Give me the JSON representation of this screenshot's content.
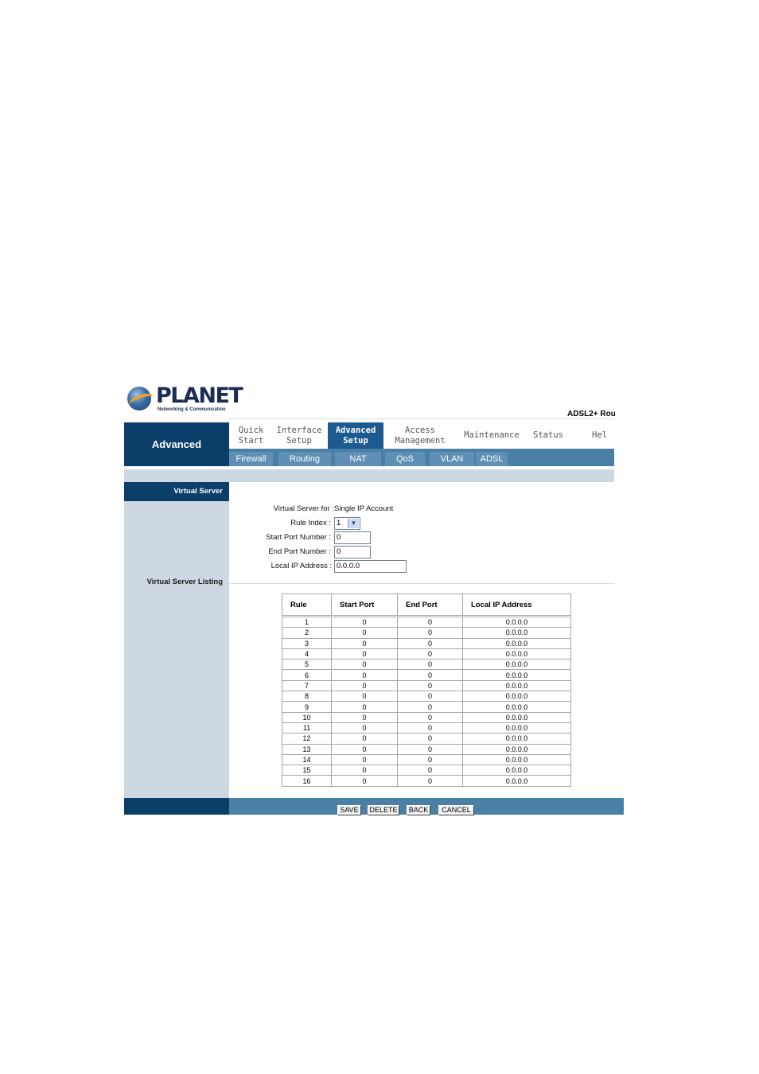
{
  "header": {
    "brand": "PLANET",
    "brand_tagline": "Networking & Communication",
    "product": "ADSL2+ Rou"
  },
  "nav": {
    "section": "Advanced",
    "main": [
      {
        "label": "Quick\nStart"
      },
      {
        "label": "Interface\nSetup"
      },
      {
        "label": "Advanced\nSetup",
        "active": true
      },
      {
        "label": "Access\nManagement"
      },
      {
        "label": "Maintenance"
      },
      {
        "label": "Status"
      },
      {
        "label": "Hel"
      }
    ],
    "sub": [
      "Firewall",
      "Routing",
      "NAT",
      "QoS",
      "VLAN",
      "ADSL"
    ]
  },
  "sidebar": {
    "virtual_server": "Virtual Server",
    "listing": "Virtual Server Listing"
  },
  "form": {
    "virtual_server_for_label": "Virtual Server for :",
    "virtual_server_for_value": "Single IP Account",
    "rule_index_label": "Rule Index :",
    "rule_index_value": "1",
    "start_port_label": "Start Port Number :",
    "start_port_value": "0",
    "end_port_label": "End Port Number :",
    "end_port_value": "0",
    "local_ip_label": "Local IP Address :",
    "local_ip_value": "0.0.0.0"
  },
  "table": {
    "headers": [
      "Rule",
      "Start Port",
      "End Port",
      "Local IP Address"
    ],
    "rows": [
      [
        "1",
        "0",
        "0",
        "0.0.0.0"
      ],
      [
        "2",
        "0",
        "0",
        "0.0.0.0"
      ],
      [
        "3",
        "0",
        "0",
        "0.0.0.0"
      ],
      [
        "4",
        "0",
        "0",
        "0.0.0.0"
      ],
      [
        "5",
        "0",
        "0",
        "0.0.0.0"
      ],
      [
        "6",
        "0",
        "0",
        "0.0.0.0"
      ],
      [
        "7",
        "0",
        "0",
        "0.0.0.0"
      ],
      [
        "8",
        "0",
        "0",
        "0.0.0.0"
      ],
      [
        "9",
        "0",
        "0",
        "0.0.0.0"
      ],
      [
        "10",
        "0",
        "0",
        "0.0.0.0"
      ],
      [
        "11",
        "0",
        "0",
        "0.0.0.0"
      ],
      [
        "12",
        "0",
        "0",
        "0.0.0.0"
      ],
      [
        "13",
        "0",
        "0",
        "0.0.0.0"
      ],
      [
        "14",
        "0",
        "0",
        "0.0.0.0"
      ],
      [
        "15",
        "0",
        "0",
        "0.0.0.0"
      ],
      [
        "16",
        "0",
        "0",
        "0.0.0.0"
      ]
    ]
  },
  "buttons": {
    "save": "SAVE",
    "delete": "DELETE",
    "back": "BACK",
    "cancel": "CANCEL"
  },
  "colors": {
    "dark_navy": "#0b3e68",
    "active_tab": "#1d5a8f",
    "sub_nav": "#4a7fa6",
    "panel_gray": "#cdd8e2"
  }
}
